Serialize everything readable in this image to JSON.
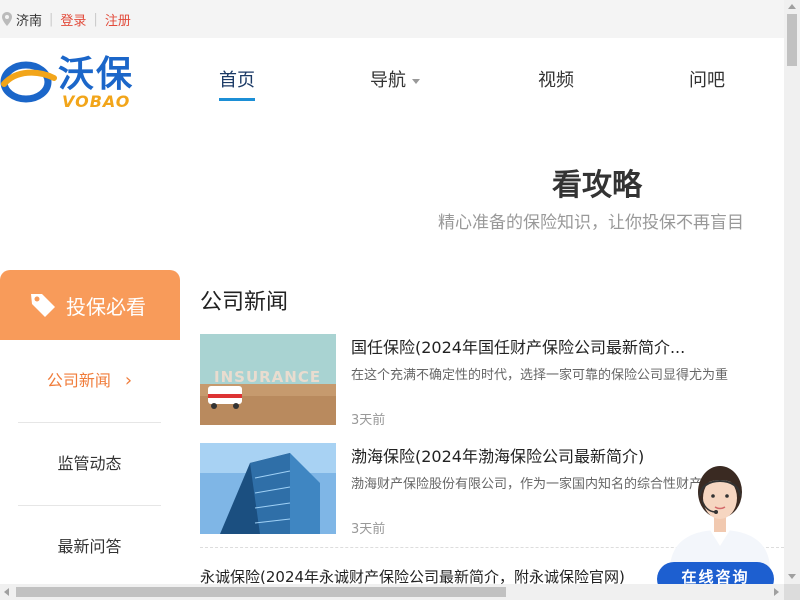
{
  "topbar": {
    "city": "济南",
    "login": "登录",
    "register": "注册"
  },
  "logo": {
    "main": "沃保",
    "sub": "VOBAO"
  },
  "nav": {
    "items": [
      "首页",
      "导航",
      "视频",
      "问吧"
    ],
    "active_index": 0
  },
  "hero": {
    "title": "看攻略",
    "subtitle": "精心准备的保险知识，让你投保不再盲目"
  },
  "sidebar": {
    "title": "投保必看",
    "items": [
      "公司新闻",
      "监管动态",
      "最新问答"
    ],
    "active_index": 0
  },
  "main": {
    "section_title": "公司新闻",
    "news": [
      {
        "title": "国任保险(2024年国任财产保险公司最新简介...",
        "desc": "在这个充满不确定性的时代，选择一家可靠的保险公司显得尤为重",
        "time": "3天前",
        "thumb_text": "INSURANCE"
      },
      {
        "title": "渤海保险(2024年渤海保险公司最新简介)",
        "desc": "渤海财产保险股份有限公司，作为一家国内知名的综合性财产保险",
        "time": "3天前"
      },
      {
        "title": "永诚保险(2024年永诚财产保险公司最新简介，附永诚保险官网)"
      }
    ]
  },
  "consult": {
    "label": "在线咨询"
  },
  "colors": {
    "accent_orange": "#f89b5a",
    "brand_blue": "#1b66c9",
    "link_red": "#e24b3b",
    "consult_blue": "#1d5fd0"
  }
}
